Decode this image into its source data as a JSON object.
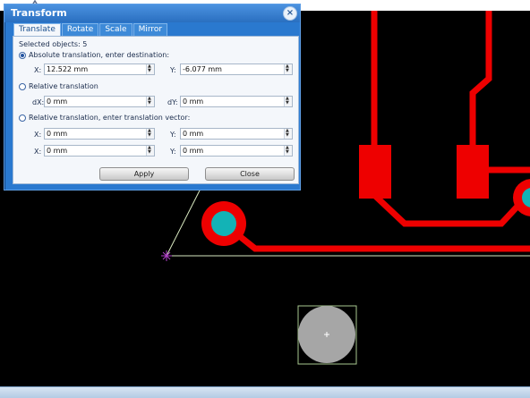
{
  "dialog": {
    "title": "Transform",
    "close_glyph": "×",
    "tabs": [
      {
        "label": "Translate",
        "active": true
      },
      {
        "label": "Rotate",
        "active": false
      },
      {
        "label": "Scale",
        "active": false
      },
      {
        "label": "Mirror",
        "active": false
      }
    ],
    "selected_objects": "Selected objects: 5",
    "absolute": {
      "label": "Absolute translation, enter destination:",
      "selected": true,
      "x_label": "X:",
      "x_value": "12.522 mm",
      "y_label": "Y:",
      "y_value": "-6.077 mm"
    },
    "relative": {
      "label": "Relative translation",
      "selected": false,
      "dx_label": "dX:",
      "dx_value": "0 mm",
      "dy_label": "dY:",
      "dy_value": "0 mm"
    },
    "vector": {
      "label": "Relative translation, enter translation vector:",
      "selected": false,
      "row1": {
        "x_label": "X:",
        "x_value": "0 mm",
        "y_label": "Y:",
        "y_value": "0 mm"
      },
      "row2": {
        "x_label": "X:",
        "x_value": "0 mm",
        "y_label": "Y:",
        "y_value": "0 mm"
      }
    },
    "apply_label": "Apply",
    "close_label": "Close"
  },
  "colors": {
    "trace": "#ee0000",
    "pad_hole": "#13b3b6",
    "outline": "#d8e8c0",
    "selection": "#a8c890",
    "component": "#a6a6a6",
    "crosshair": "#b040c8"
  },
  "icons": {
    "spin_up": "▲",
    "spin_down": "▼"
  }
}
